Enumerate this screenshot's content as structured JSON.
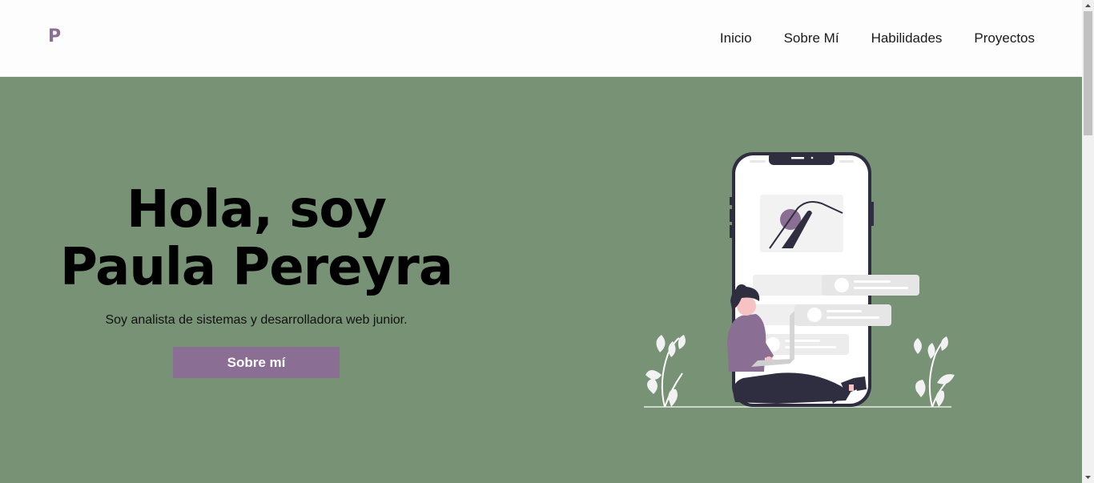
{
  "header": {
    "logo": "P",
    "nav": [
      "Inicio",
      "Sobre Mí",
      "Habilidades",
      "Proyectos"
    ]
  },
  "hero": {
    "title_line1": "Hola, soy",
    "title_line2": "Paula Pereyra",
    "subtitle": "Soy analista de sistemas y desarrolladora web junior.",
    "cta_label": "Sobre mí"
  },
  "colors": {
    "accent": "#8a6e93",
    "hero_background": "#779274",
    "header_background": "#fdfdfd"
  },
  "icons": {
    "illustration": "woman-with-laptop-and-phone-illustration"
  }
}
